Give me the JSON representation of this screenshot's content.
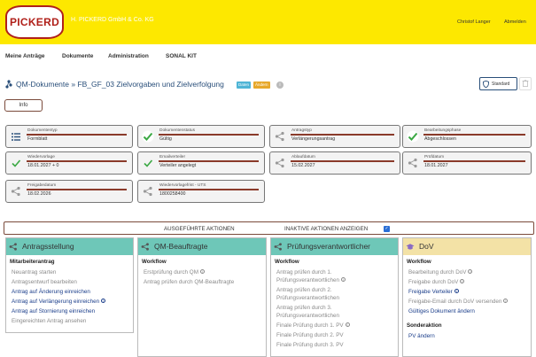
{
  "header": {
    "logo_text": "PICKERD",
    "company": "H. PICKERD GmbH & Co. KG",
    "user": "Christof Langer",
    "logout": "Abmelden"
  },
  "nav": {
    "items": [
      "Meine Anträge",
      "Dokumente",
      "Administration",
      "SONAL KIT"
    ]
  },
  "page": {
    "title": "QM-Dokumente » FB_GF_03 Zielvorgaben und Zielverfolgung",
    "badge_blue": "Daten",
    "badge_orange": "Ändern",
    "standard_button": "Standard",
    "info_button": "Info"
  },
  "fields": [
    {
      "label": "Dokumententyp",
      "value": "Formblatt",
      "icon": "list-icon"
    },
    {
      "label": "Dokumentenstatus",
      "value": "Gültig",
      "icon": "check-icon"
    },
    {
      "label": "Antragstyp",
      "value": "Verlängerungsantrag",
      "icon": "share-icon"
    },
    {
      "label": "Bearbeitungsphase",
      "value": "Abgeschlossen",
      "icon": "check-icon"
    },
    {
      "label": "Wiedervorlage",
      "value": "18.01.2027 + 0",
      "icon": "check-icon"
    },
    {
      "label": "Emailverteiler",
      "value": "Verteiler angelegt",
      "icon": "check-icon"
    },
    {
      "label": "Ablaufdatum",
      "value": "15.02.2027",
      "icon": "share-icon"
    },
    {
      "label": "Prüfdatum",
      "value": "18.01.2027",
      "icon": "share-icon"
    },
    {
      "label": "Freigabedatum",
      "value": "18.02.2026",
      "icon": "share-icon"
    },
    {
      "label": "Wiedervorlagefrist - UTS",
      "value": "1800258400",
      "icon": "share-icon"
    }
  ],
  "actions": {
    "executed": "AUSGEFÜHRTE AKTIONEN",
    "inactive": "INAKTIVE AKTIONEN ANZEIGEN",
    "inactive_checked": true
  },
  "columns": [
    {
      "title": "Antragsstellung",
      "color": "#6ec7b8",
      "section": "Mitarbeiterantrag",
      "items": [
        {
          "text": "Neuantrag starten",
          "link": false,
          "info": false
        },
        {
          "text": "Antragsentwurf bearbeiten",
          "link": false,
          "info": false
        },
        {
          "text": "Antrag auf Änderung einreichen",
          "link": true,
          "info": false
        },
        {
          "text": "Antrag auf Verlängerung einreichen",
          "link": true,
          "info": true
        },
        {
          "text": "Antrag auf Stornierung einreichen",
          "link": true,
          "info": false
        },
        {
          "text": "Eingereichten Antrag ansehen",
          "link": false,
          "info": false
        }
      ]
    },
    {
      "title": "QM-Beauftragte",
      "color": "#6ec7b8",
      "section": "Workflow",
      "items": [
        {
          "text": "Erstprüfung durch QM",
          "link": false,
          "info": true
        },
        {
          "text": "Antrag prüfen durch QM-Beauftragte",
          "link": false,
          "info": false
        }
      ]
    },
    {
      "title": "Prüfungsverantwortlicher",
      "color": "#6ec7b8",
      "section": "Workflow",
      "items": [
        {
          "text": "Antrag prüfen durch 1.",
          "link": false,
          "info": false
        },
        {
          "text": "Prüfungsverantwortlichen",
          "link": false,
          "info": true
        },
        {
          "text": "Antrag prüfen durch 2.",
          "link": false,
          "info": false
        },
        {
          "text": "Prüfungsverantwortlichen",
          "link": false,
          "info": false
        },
        {
          "text": "Antrag prüfen durch 3.",
          "link": false,
          "info": false
        },
        {
          "text": "Prüfungsverantwortlichen",
          "link": false,
          "info": false
        },
        {
          "text": "Finale Prüfung durch 1. PV",
          "link": false,
          "info": true
        },
        {
          "text": "Finale Prüfung durch 2. PV",
          "link": false,
          "info": false
        },
        {
          "text": "Finale Prüfung durch 3. PV",
          "link": false,
          "info": false
        }
      ]
    },
    {
      "title": "DoV",
      "color": "#f3e2a6",
      "section": "Workflow",
      "items": [
        {
          "text": "Bearbeitung durch DoV",
          "link": false,
          "info": true
        },
        {
          "text": "Freigabe durch DoV",
          "link": false,
          "info": true
        },
        {
          "text": "Freigabe Verteiler",
          "link": true,
          "info": true
        },
        {
          "text": "Freigabe-Email durch DoV versenden",
          "link": false,
          "info": true
        },
        {
          "text": "Gültiges Dokument ändern",
          "link": true,
          "info": false
        }
      ],
      "section2": "Sonderaktion",
      "items2": [
        {
          "text": "PV ändern",
          "link": true,
          "info": false
        }
      ]
    }
  ],
  "colors": {
    "header_yellow": "#fde800",
    "brand_red": "#b0201a",
    "title_blue": "#2a4f7a",
    "teal": "#6ec7b8",
    "link_blue": "#1a3d8a"
  }
}
